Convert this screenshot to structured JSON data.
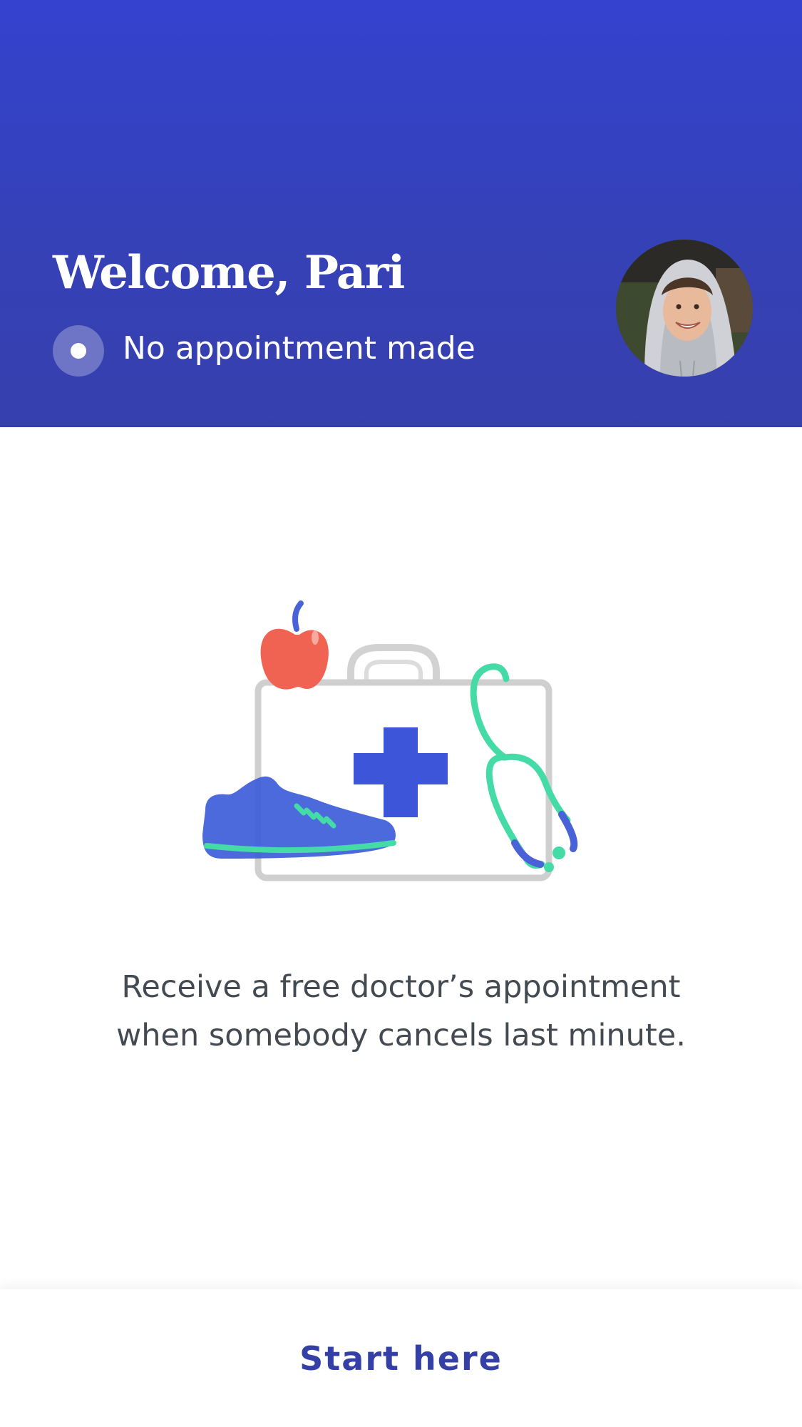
{
  "header": {
    "welcome": "Welcome, Pari",
    "status_text": "No appointment made",
    "avatar_icon": "user-avatar"
  },
  "illustration": {
    "icons": [
      "apple-icon",
      "medical-kit-icon",
      "stethoscope-icon",
      "sneaker-icon"
    ]
  },
  "main": {
    "message_line1": "Receive a free doctor’s appointment",
    "message_line2": "when somebody cancels last minute."
  },
  "footer": {
    "start_label": "Start here"
  },
  "colors": {
    "header_top": "#3442cf",
    "header_bottom": "#3640ad",
    "accent": "#3540a6",
    "text": "#444a52"
  }
}
